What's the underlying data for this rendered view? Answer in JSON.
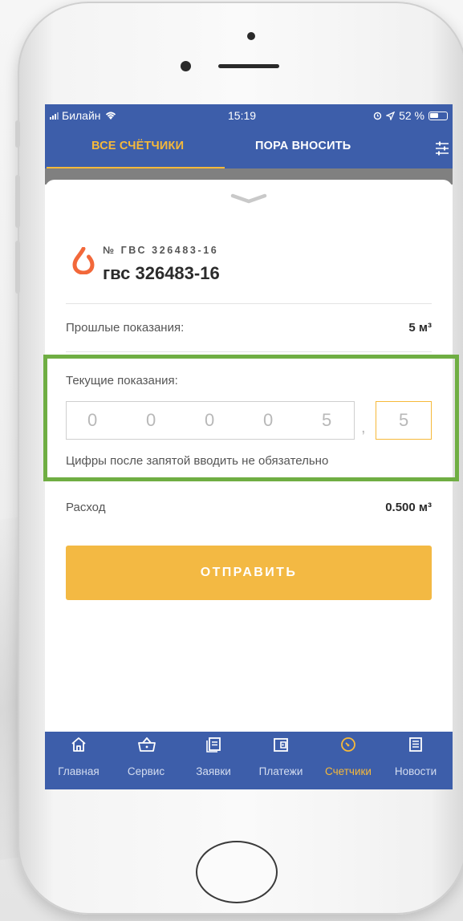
{
  "status_bar": {
    "carrier": "Билайн",
    "time": "15:19",
    "battery_text": "52 %"
  },
  "tabs": [
    {
      "label": "ВСЕ СЧЁТЧИКИ",
      "active": true
    },
    {
      "label": "ПОРА ВНОСИТЬ",
      "active": false
    }
  ],
  "meter": {
    "number": "№ ГВС 326483-16",
    "name": "гвс 326483-16"
  },
  "previous": {
    "label": "Прошлые показания:",
    "value": "5 м³"
  },
  "current": {
    "label": "Текущие показания:",
    "digits": [
      "0",
      "0",
      "0",
      "0",
      "5"
    ],
    "comma": ",",
    "fraction": "5",
    "hint": "Цифры после запятой вводить не обязательно"
  },
  "consumption": {
    "label": "Расход",
    "value": "0.500 м³"
  },
  "submit_button": "ОТПРАВИТЬ",
  "nav": [
    {
      "label": "Главная",
      "icon": "home-icon"
    },
    {
      "label": "Сервис",
      "icon": "basket-icon"
    },
    {
      "label": "Заявки",
      "icon": "document-icon"
    },
    {
      "label": "Платежи",
      "icon": "wallet-icon"
    },
    {
      "label": "Счетчики",
      "icon": "meter-gauge-icon",
      "active": true
    },
    {
      "label": "Новости",
      "icon": "newspaper-icon"
    }
  ],
  "colors": {
    "primary": "#3d5eaa",
    "accent": "#f6b93a",
    "highlight": "#6fae43",
    "drop": "#f2683a"
  }
}
